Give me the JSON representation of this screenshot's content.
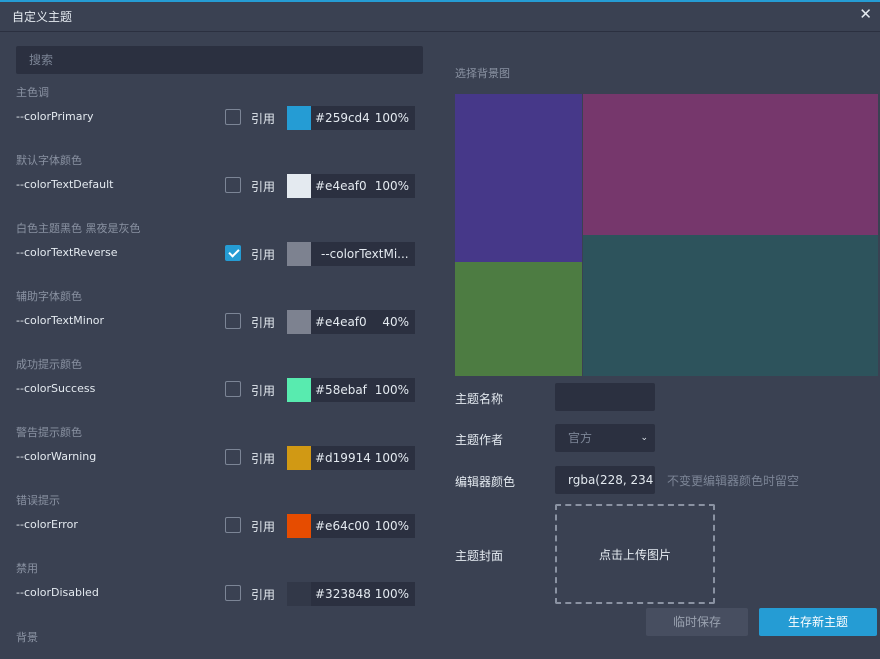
{
  "dialog": {
    "title": "自定义主题",
    "close_glyph": "✕"
  },
  "search": {
    "placeholder": "搜索"
  },
  "ref_label": "引用",
  "variables": [
    {
      "group": "主色调",
      "name": "--colorPrimary",
      "checked": false,
      "swatch": "#259cd4",
      "hex": "#259cd4",
      "alpha": "100%"
    },
    {
      "group": "默认字体颜色",
      "name": "--colorTextDefault",
      "checked": false,
      "swatch": "#e4eaf0",
      "hex": "#e4eaf0",
      "alpha": "100%"
    },
    {
      "group": "白色主题黑色 黑夜是灰色",
      "name": "--colorTextReverse",
      "checked": true,
      "swatch": "#7d8290",
      "ref_value": "--colorTextMi..."
    },
    {
      "group": "辅助字体颜色",
      "name": "--colorTextMinor",
      "checked": false,
      "swatch": "#7d8290",
      "hex": "#e4eaf0",
      "alpha": "40%"
    },
    {
      "group": "成功提示颜色",
      "name": "--colorSuccess",
      "checked": false,
      "swatch": "#58ebaf",
      "hex": "#58ebaf",
      "alpha": "100%"
    },
    {
      "group": "警告提示颜色",
      "name": "--colorWarning",
      "checked": false,
      "swatch": "#d19914",
      "hex": "#d19914",
      "alpha": "100%"
    },
    {
      "group": "错误提示",
      "name": "--colorError",
      "checked": false,
      "swatch": "#e64c00",
      "hex": "#e64c00",
      "alpha": "100%"
    },
    {
      "group": "禁用",
      "name": "--colorDisabled",
      "checked": false,
      "swatch": "#323848",
      "hex": "#323848",
      "alpha": "100%"
    }
  ],
  "bottom_section": "背景",
  "right": {
    "bg_label": "选择背景图",
    "preview_colors": {
      "top_left": "#463889",
      "bottom_left": "#4d7c42",
      "top_right": "#76376c",
      "bottom_right": "#2d535c"
    },
    "theme_name_label": "主题名称",
    "theme_name_value": "",
    "author_label": "主题作者",
    "author_value": "官方",
    "editor_color_label": "编辑器颜色",
    "editor_color_value": "rgba(228, 234",
    "editor_color_hint": "不变更编辑器颜色时留空",
    "cover_label": "主题封面",
    "upload_text": "点击上传图片",
    "temp_save_button": "临时保存",
    "new_theme_button": "生存新主题"
  }
}
